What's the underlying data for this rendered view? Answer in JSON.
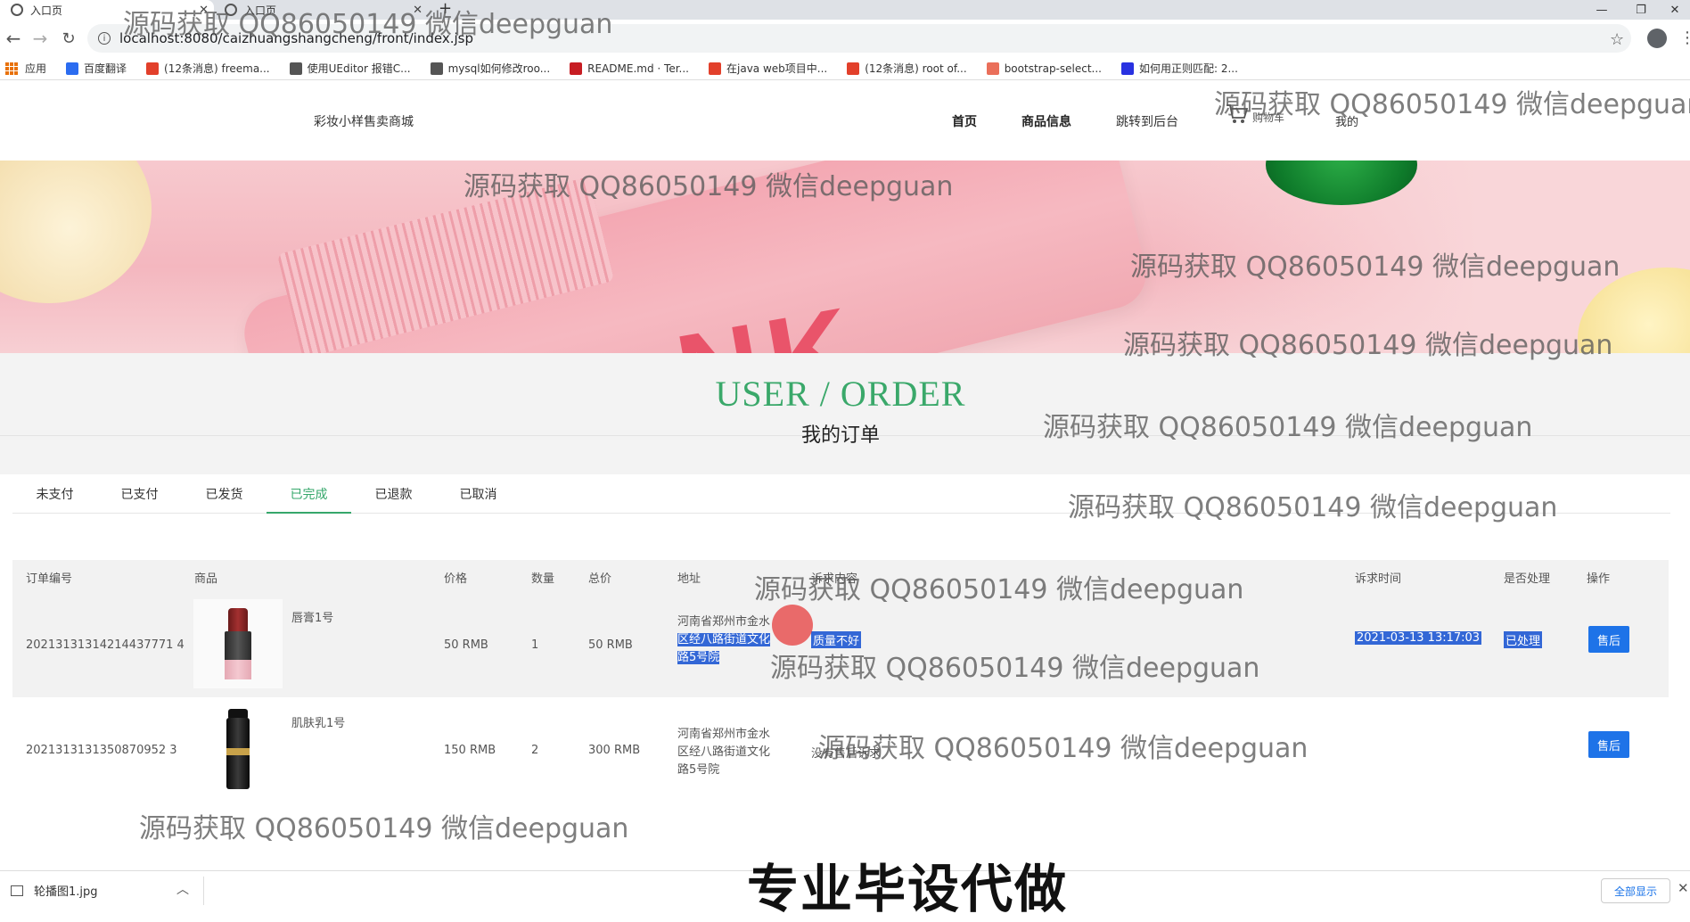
{
  "browser": {
    "tabs": [
      {
        "title": "入口页"
      },
      {
        "title": "入口页"
      }
    ],
    "new_tab": "+",
    "window_controls": {
      "minimize": "—",
      "restore": "❐",
      "close": "✕"
    },
    "url": "localhost:8080/caizhuangshangcheng/front/index.jsp",
    "bookmarks": [
      {
        "label": "应用",
        "icon": "apps-icon",
        "color": "#e8710a"
      },
      {
        "label": "百度翻译",
        "icon": "translate-icon",
        "color": "#2b6cf0"
      },
      {
        "label": "(12条消息) freema...",
        "icon": "csdn-icon",
        "color": "#e2402b"
      },
      {
        "label": "使用UEditor 报错C...",
        "icon": "blog-icon",
        "color": "#555555"
      },
      {
        "label": "mysql如何修改roo...",
        "icon": "blog-icon",
        "color": "#555555"
      },
      {
        "label": "README.md · Ter...",
        "icon": "gitee-icon",
        "color": "#c71d23"
      },
      {
        "label": "在java web项目中...",
        "icon": "csdn-icon",
        "color": "#e2402b"
      },
      {
        "label": "(12条消息) root of...",
        "icon": "csdn-icon",
        "color": "#e2402b"
      },
      {
        "label": "bootstrap-select...",
        "icon": "jianshu-icon",
        "color": "#ea6f5a"
      },
      {
        "label": "如何用正则匹配: 2...",
        "icon": "baidu-icon",
        "color": "#2932e1"
      }
    ]
  },
  "site": {
    "title": "彩妆小样售卖商城",
    "nav": [
      {
        "label": "首页"
      },
      {
        "label": "商品信息"
      },
      {
        "label": "跳转到后台"
      },
      {
        "label": "购物车"
      },
      {
        "label": "我的"
      }
    ]
  },
  "section": {
    "title_en": "USER / ORDER",
    "title_zh": "我的订单"
  },
  "order_tabs": [
    {
      "label": "未支付"
    },
    {
      "label": "已支付"
    },
    {
      "label": "已发货"
    },
    {
      "label": "已完成",
      "active": true
    },
    {
      "label": "已退款"
    },
    {
      "label": "已取消"
    }
  ],
  "table": {
    "headers": {
      "order_no": "订单编号",
      "product": "商品",
      "price": "价格",
      "qty": "数量",
      "total": "总价",
      "address": "地址",
      "reason": "诉求内容",
      "time": "诉求时间",
      "handled": "是否处理",
      "action": "操作"
    },
    "rows": [
      {
        "order_no": "20213131314214437771 4",
        "product_name": "唇膏1号",
        "product_icon": "lipstick-image",
        "price": "50 RMB",
        "qty": "1",
        "total": "50 RMB",
        "address_l1": "河南省郑州市金水",
        "address_l2": "区经八路街道文化",
        "address_l3": "路5号院",
        "reason": "质量不好",
        "time": "2021-03-13 13:17:03",
        "handled": "已处理",
        "action": "售后"
      },
      {
        "order_no": "2021313131350870952 3",
        "product_name": "肌肤乳1号",
        "product_icon": "serum-image",
        "price": "150 RMB",
        "qty": "2",
        "total": "300 RMB",
        "address_l1": "河南省郑州市金水",
        "address_l2": "区经八路街道文化",
        "address_l3": "路5号院",
        "reason": "没有售后诉求",
        "time": "",
        "handled": "",
        "action": "售后"
      }
    ]
  },
  "downloads": {
    "file": "轮播图1.jpg",
    "show_all": "全部显示"
  },
  "watermark": "源码获取 QQ86050149 微信deepguan",
  "caption": "专业毕设代做",
  "colors": {
    "accent_green": "#36a76b",
    "button_blue": "#1e73e8",
    "selection_blue": "#3367d6"
  }
}
